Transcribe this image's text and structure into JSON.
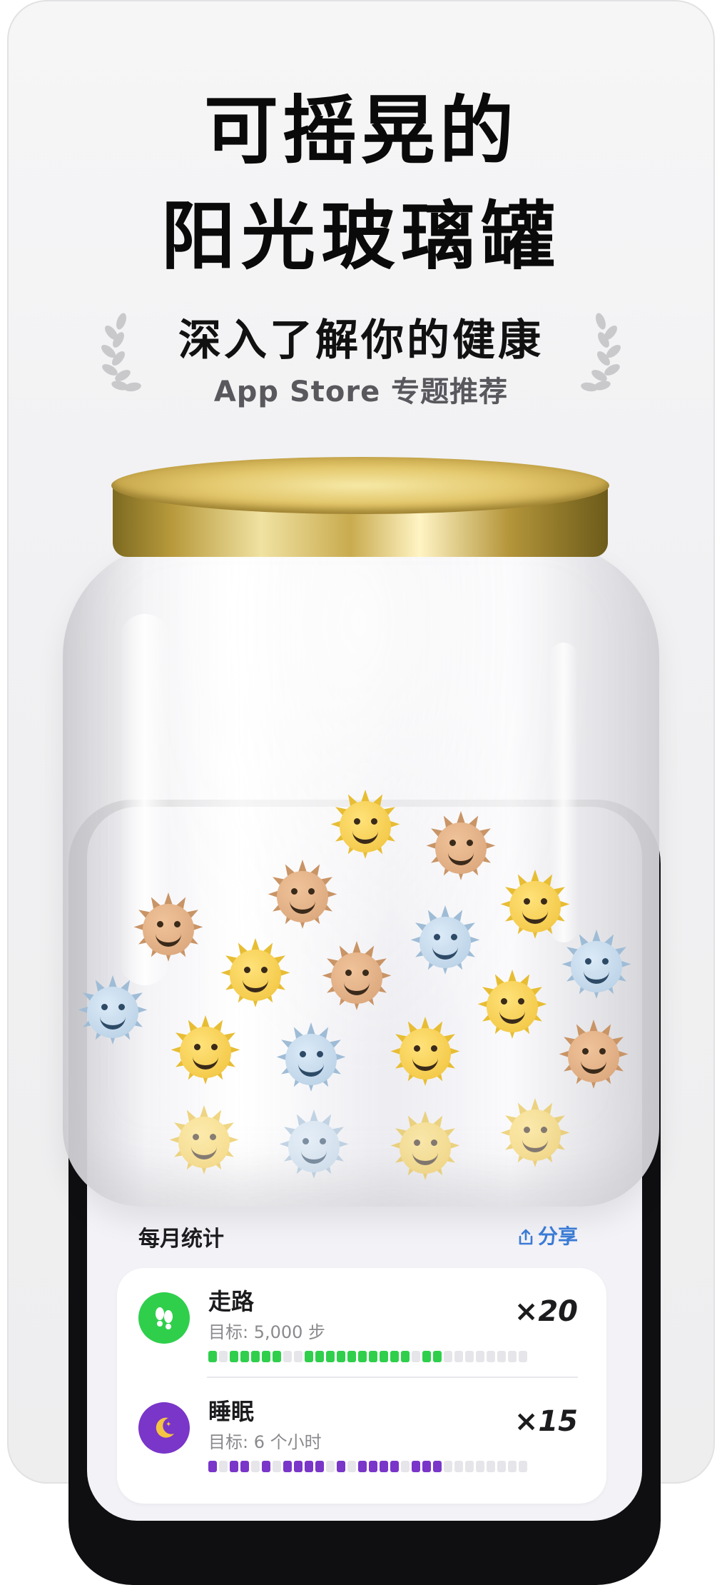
{
  "headline": {
    "line1": "可摇晃的",
    "line2": "阳光玻璃罐"
  },
  "award": {
    "title": "深入了解你的健康",
    "subtitle": "App Store 专题推荐"
  },
  "stats": {
    "header": "每月统计",
    "share_label": "分享",
    "rows": [
      {
        "title": "走路",
        "goal": "目标: 5,000 步",
        "count": "×20",
        "icon": "footsteps-icon",
        "color": "#2fcf4c",
        "segments": [
          1,
          0,
          1,
          1,
          1,
          1,
          1,
          0,
          0,
          1,
          1,
          1,
          1,
          1,
          1,
          1,
          1,
          1,
          1,
          0,
          1,
          1,
          0,
          0,
          0,
          0,
          0,
          0,
          0,
          0
        ]
      },
      {
        "title": "睡眠",
        "goal": "目标: 6 个小时",
        "count": "×15",
        "icon": "moon-icon",
        "color": "#7a35c9",
        "segments": [
          1,
          0,
          1,
          1,
          0,
          1,
          0,
          1,
          1,
          1,
          1,
          0,
          1,
          0,
          1,
          1,
          1,
          1,
          0,
          1,
          1,
          1,
          0,
          0,
          0,
          0,
          0,
          0,
          0,
          0
        ]
      }
    ]
  },
  "colors": {
    "walk_green": "#2fcf4c",
    "sleep_purple": "#7a35c9",
    "share_blue": "#3a7bd5",
    "lid_gold": "#d9bb5a"
  }
}
